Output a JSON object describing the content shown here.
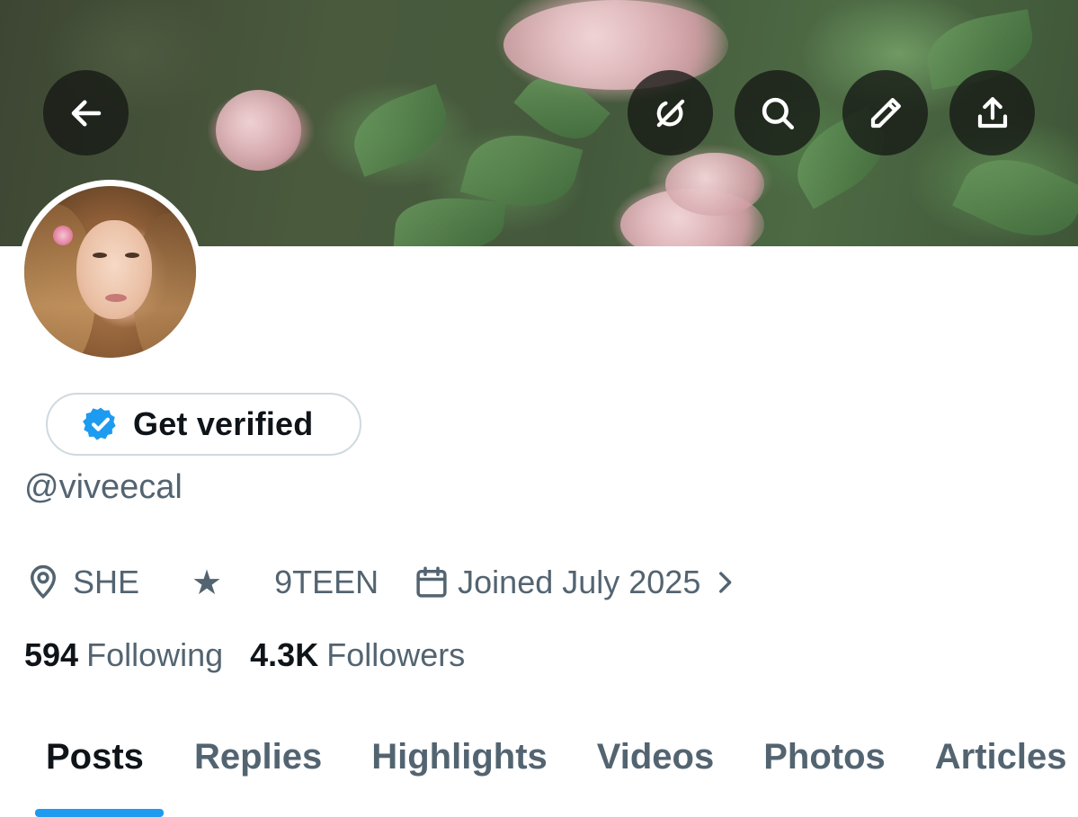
{
  "header": {
    "back_icon": "arrow-left-icon",
    "actions": [
      {
        "name": "grok-icon"
      },
      {
        "name": "search-icon"
      },
      {
        "name": "pencil-icon"
      },
      {
        "name": "share-icon"
      }
    ]
  },
  "profile": {
    "verify_label": "Get verified",
    "verify_badge_color": "#1d9bf0",
    "handle": "@viveecal",
    "location": "SHE",
    "star_glyph": "★",
    "bio_link": "9TEEN",
    "joined": "Joined July 2025",
    "following_count": "594",
    "following_label": "Following",
    "followers_count": "4.3K",
    "followers_label": "Followers"
  },
  "tabs": [
    {
      "label": "Posts",
      "active": true
    },
    {
      "label": "Replies",
      "active": false
    },
    {
      "label": "Highlights",
      "active": false
    },
    {
      "label": "Videos",
      "active": false
    },
    {
      "label": "Photos",
      "active": false
    },
    {
      "label": "Articles",
      "active": false
    }
  ],
  "colors": {
    "accent": "#1d9bf0",
    "secondary_text": "#536471",
    "primary_text": "#0f1419"
  }
}
